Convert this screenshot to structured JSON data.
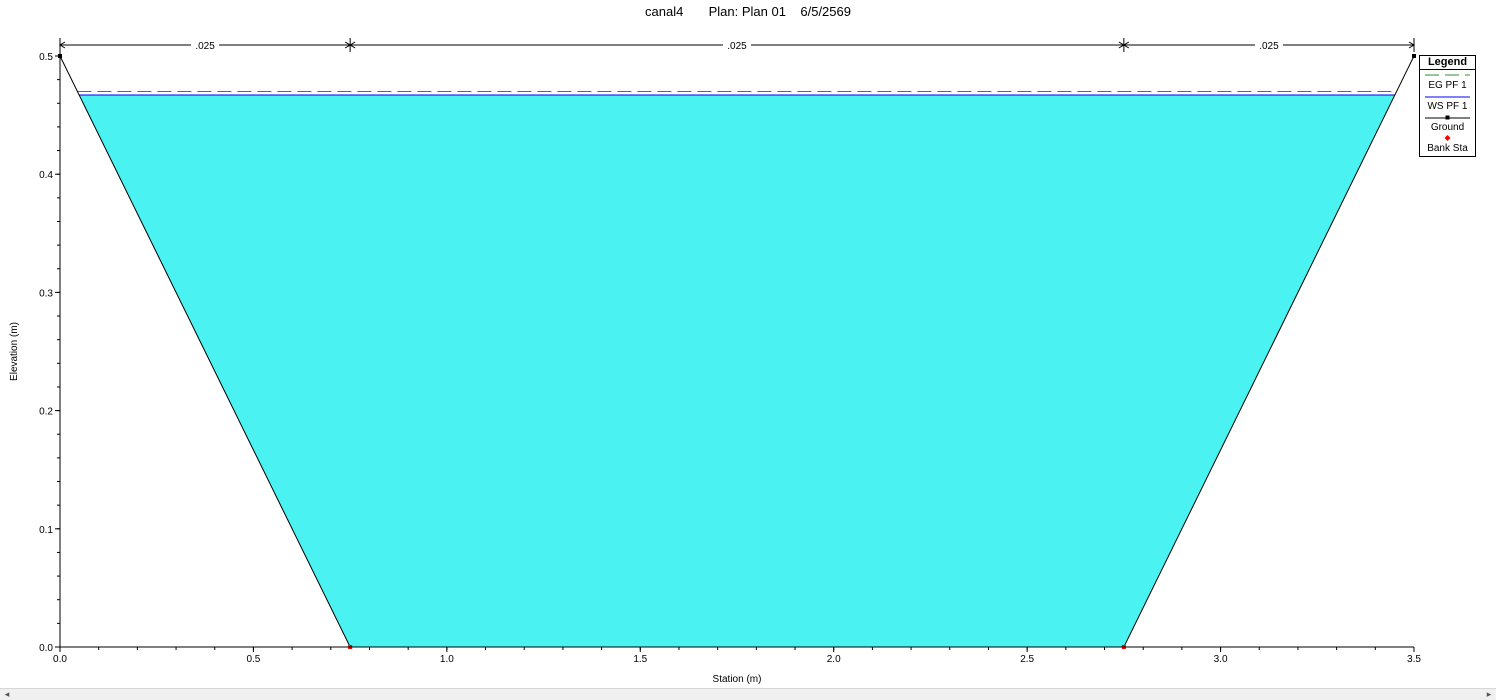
{
  "title": "canal4       Plan: Plan 01    6/5/2569",
  "chart_data": {
    "type": "area",
    "xlabel": "Station (m)",
    "ylabel": "Elevation (m)",
    "xlim": [
      0,
      3.5
    ],
    "ylim": [
      0,
      0.5
    ],
    "x_ticks": [
      0.0,
      0.5,
      1.0,
      1.5,
      2.0,
      2.5,
      3.0,
      3.5
    ],
    "x_tick_labels": [
      "0.0",
      "0.5",
      "1.0",
      "1.5",
      "2.0",
      "2.5",
      "3.0",
      "3.5"
    ],
    "y_ticks": [
      0.0,
      0.1,
      0.2,
      0.3,
      0.4,
      0.5
    ],
    "y_tick_labels": [
      "0.0",
      "0.1",
      "0.2",
      "0.3",
      "0.4",
      "0.5"
    ],
    "ground": {
      "x": [
        0,
        0.75,
        2.75,
        3.5
      ],
      "y": [
        0.5,
        0,
        0,
        0.5
      ]
    },
    "bank_stations": {
      "x": [
        0.75,
        2.75
      ],
      "y": [
        0,
        0
      ]
    },
    "ws_elevation": 0.467,
    "eg_elevation": 0.47,
    "mannings_n": [
      {
        "label": ".025",
        "from": 0,
        "to": 0.75
      },
      {
        "label": ".025",
        "from": 0.75,
        "to": 2.75
      },
      {
        "label": ".025",
        "from": 2.75,
        "to": 3.5
      }
    ],
    "legend": {
      "title": "Legend",
      "placement": "right",
      "items": [
        "EG PF 1",
        "WS PF 1",
        "Ground",
        "Bank Sta"
      ]
    },
    "colors": {
      "water": "#4af2f2",
      "eg_line": "#2e8b2e",
      "ws_line": "#0000ff",
      "ground": "#000000",
      "bank": "#ff0000"
    }
  },
  "scrollbar": {
    "left_arrow": "◂",
    "right_arrow": "▸"
  }
}
